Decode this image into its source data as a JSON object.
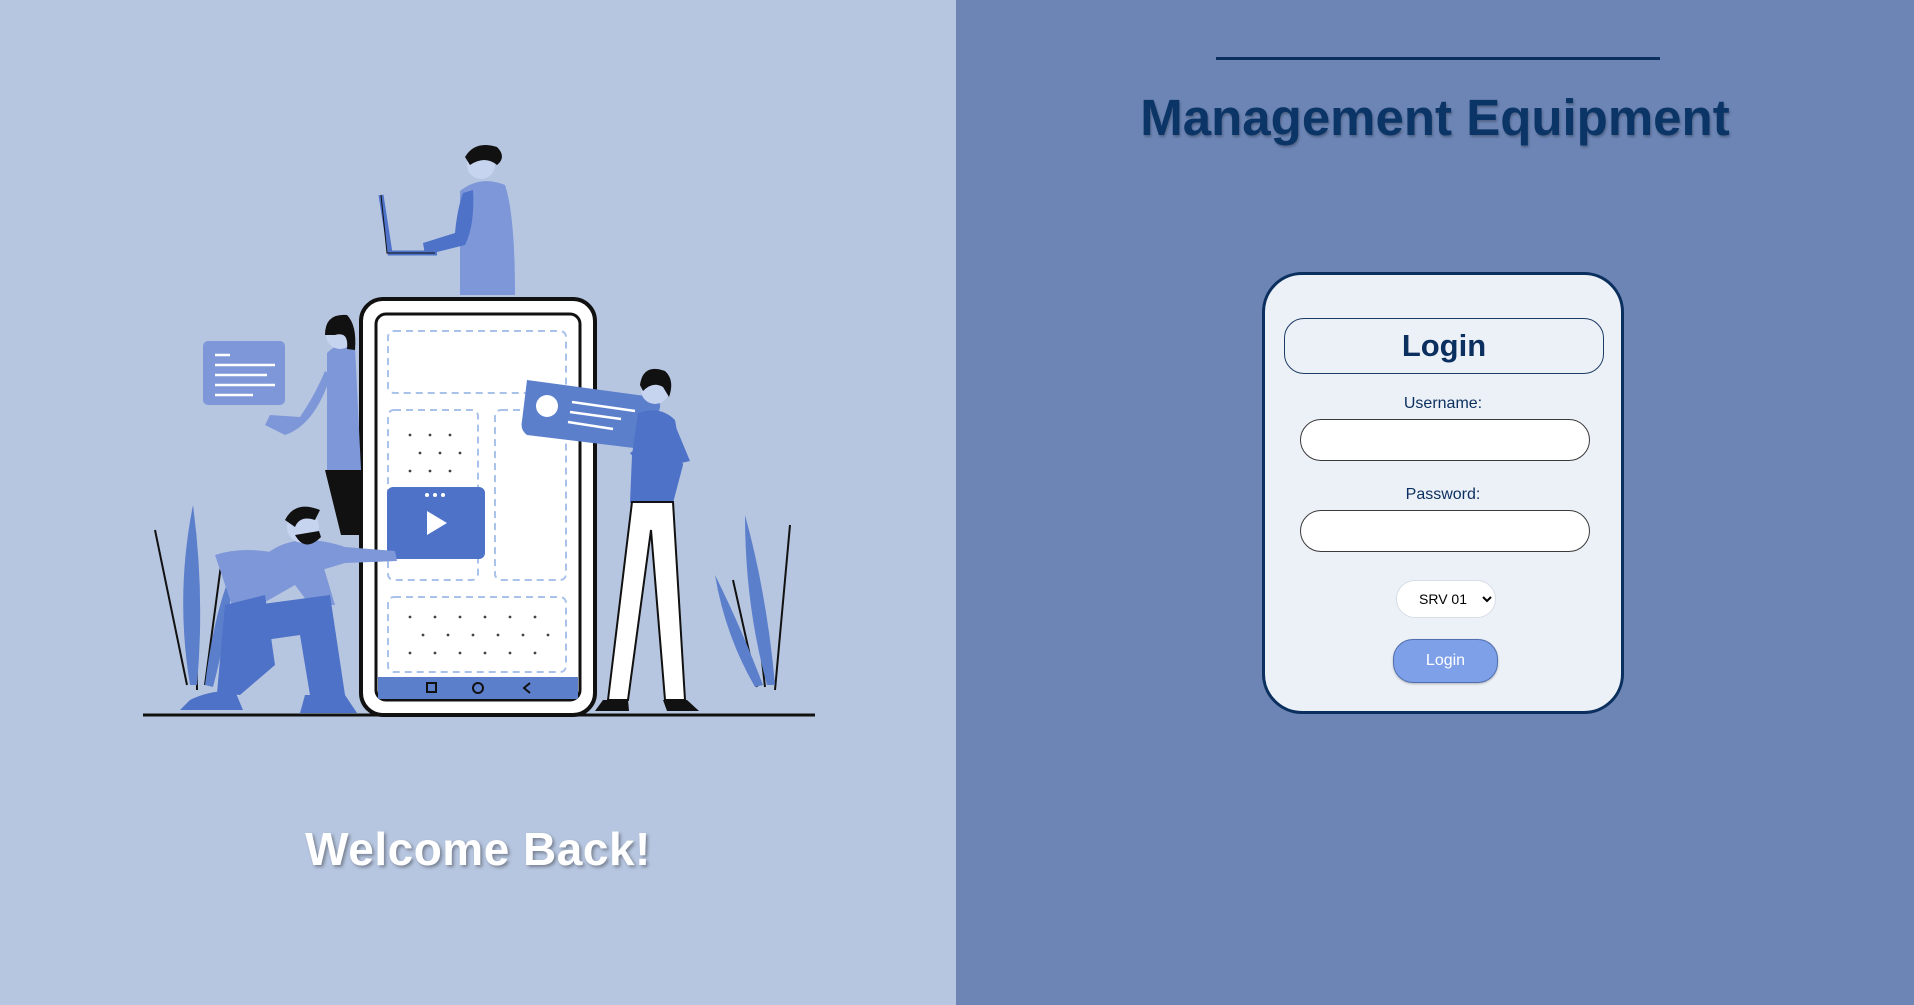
{
  "left": {
    "welcome_text": "Welcome Back!"
  },
  "right": {
    "app_title": "Management Equipment",
    "login_form": {
      "title": "Login",
      "username_label": "Username:",
      "username_value": "",
      "password_label": "Password:",
      "password_value": "",
      "server_selected": "SRV 01",
      "submit_label": "Login"
    }
  },
  "colors": {
    "left_background": "#b7c6e0",
    "right_background": "#6c85b5",
    "title_navy": "#0b3566",
    "card_background": "#ecf0f7",
    "button_background": "#7ea0e8",
    "illustration_blue": "#4e72c8"
  },
  "icons": [
    "people-with-phone-illustration",
    "play-icon",
    "chevron-down-icon"
  ]
}
